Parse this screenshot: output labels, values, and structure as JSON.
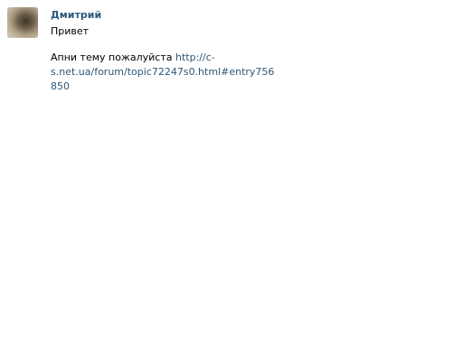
{
  "message": {
    "author_name": "Дмитрий",
    "greeting": "Привет",
    "body_text": "Апни тему пожалуйста ",
    "link_text": "http://c-s.net.ua/forum/topic72247s0.html#entry756850"
  },
  "colors": {
    "link": "#2b587a",
    "text": "#000000",
    "background": "#ffffff"
  }
}
